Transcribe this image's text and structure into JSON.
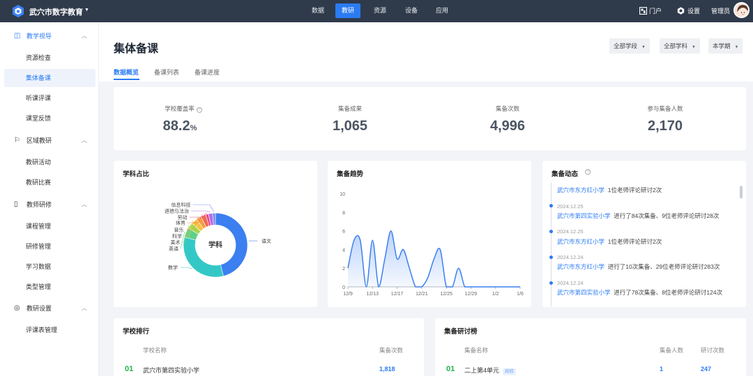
{
  "topbar": {
    "brand": "武穴市数字教育",
    "nav": [
      "数据",
      "教研",
      "资源",
      "设备",
      "应用"
    ],
    "nav_active": "教研",
    "portal": "门户",
    "settings": "设置",
    "admin": "管理员"
  },
  "sidebar": {
    "groups": [
      {
        "label": "教学视导",
        "icon": "book-icon",
        "items": [
          "资源检查",
          "集体备课",
          "听课评课",
          "课堂反馈"
        ]
      },
      {
        "label": "区域教研",
        "icon": "flag-icon",
        "items": [
          "教研活动",
          "教研比赛"
        ]
      },
      {
        "label": "教师研修",
        "icon": "open-book-icon",
        "items": [
          "课程管理",
          "研修管理",
          "学习数据",
          "类型管理"
        ]
      },
      {
        "label": "教研设置",
        "icon": "gear-icon",
        "items": [
          "评课表管理"
        ]
      }
    ],
    "active_item": "集体备课"
  },
  "page": {
    "title": "集体备课",
    "tabs": [
      "数据概览",
      "备课列表",
      "备课进度"
    ],
    "active_tab": "数据概览",
    "filters": [
      "全部学段",
      "全部学科",
      "本学期"
    ]
  },
  "stats": [
    {
      "label": "学校覆盖率",
      "value": "88.2",
      "unit": "%",
      "has_info": true
    },
    {
      "label": "集备成果",
      "value": "1,065"
    },
    {
      "label": "集备次数",
      "value": "4,996"
    },
    {
      "label": "参与集备人数",
      "value": "2,170"
    }
  ],
  "subject_chart": {
    "title": "学科占比",
    "center_label": "学科"
  },
  "trend_chart": {
    "title": "集备趋势"
  },
  "feed": {
    "title": "集备动态",
    "items": [
      {
        "date": "",
        "school": "武穴市东方红小学",
        "text": "1位老师评论研讨2次"
      },
      {
        "date": "2024.12.25",
        "school": "武穴市第四实验小学",
        "text": "进行了84次集备、9位老师评论研讨28次"
      },
      {
        "date": "2024.12.25",
        "school": "武穴市东方红小学",
        "text": "1位老师评论研讨2次"
      },
      {
        "date": "2024.12.24",
        "school": "武穴市东方红小学",
        "text": "进行了10次集备、29位老师评论研讨283次"
      },
      {
        "date": "2024.12.24",
        "school": "武穴市第四实验小学",
        "text": "进行了78次集备、8位老师评论研讨124次"
      }
    ]
  },
  "school_ranking": {
    "title": "学校排行",
    "headers": [
      "学校名称",
      "集备次数"
    ],
    "rows": [
      {
        "rank": "01",
        "name": "武穴市第四实验小学",
        "count": "1,818"
      }
    ]
  },
  "discussion_ranking": {
    "title": "集备研讨榜",
    "headers": [
      "集备名称",
      "集备人数",
      "研讨次数"
    ],
    "rows": [
      {
        "rank": "01",
        "name": "二上第4单元",
        "tag": "跨校",
        "people": "1",
        "discussions": "247"
      }
    ]
  },
  "colors": {
    "accent": "#2b7bf3",
    "topbar": "#2f3b4b",
    "rank_green": "#22b14c"
  },
  "chart_data": [
    {
      "type": "pie",
      "title": "学科占比",
      "labels": [
        "语文",
        "数学",
        "英语",
        "美术",
        "科学",
        "音乐",
        "体育",
        "劳动",
        "道德与法治",
        "信息科技"
      ],
      "values": [
        46,
        33,
        5,
        3,
        3,
        2.5,
        2.5,
        1.5,
        2,
        1.5
      ],
      "colors": [
        "#3b7ff0",
        "#33c8c6",
        "#5fd08a",
        "#a5d64b",
        "#f6c341",
        "#f59e42",
        "#ef6a53",
        "#e84a8a",
        "#b06ce8",
        "#7d8cf0"
      ]
    },
    {
      "type": "area",
      "title": "集备趋势",
      "x_ticks": [
        "12/9",
        "12/13",
        "12/17",
        "12/21",
        "12/25",
        "12/29",
        "1/2",
        "1/6"
      ],
      "y_ticks": [
        0,
        2,
        4,
        6,
        8,
        10
      ],
      "ylim": [
        0,
        10
      ],
      "x": [
        "12/9",
        "12/10",
        "12/11",
        "12/12",
        "12/13",
        "12/14",
        "12/15",
        "12/16",
        "12/17",
        "12/18",
        "12/19",
        "12/20",
        "12/21",
        "12/22",
        "12/23",
        "12/24",
        "12/25",
        "12/26",
        "12/27",
        "12/28",
        "12/29",
        "12/30",
        "12/31",
        "1/1",
        "1/2",
        "1/3",
        "1/4",
        "1/5",
        "1/6"
      ],
      "values": [
        2,
        5,
        5,
        0,
        5,
        0,
        3,
        6,
        3,
        4,
        2,
        0,
        0,
        1,
        3,
        4,
        0,
        0,
        2,
        0,
        0,
        0,
        0,
        0,
        0,
        0,
        0,
        0,
        0
      ]
    }
  ]
}
